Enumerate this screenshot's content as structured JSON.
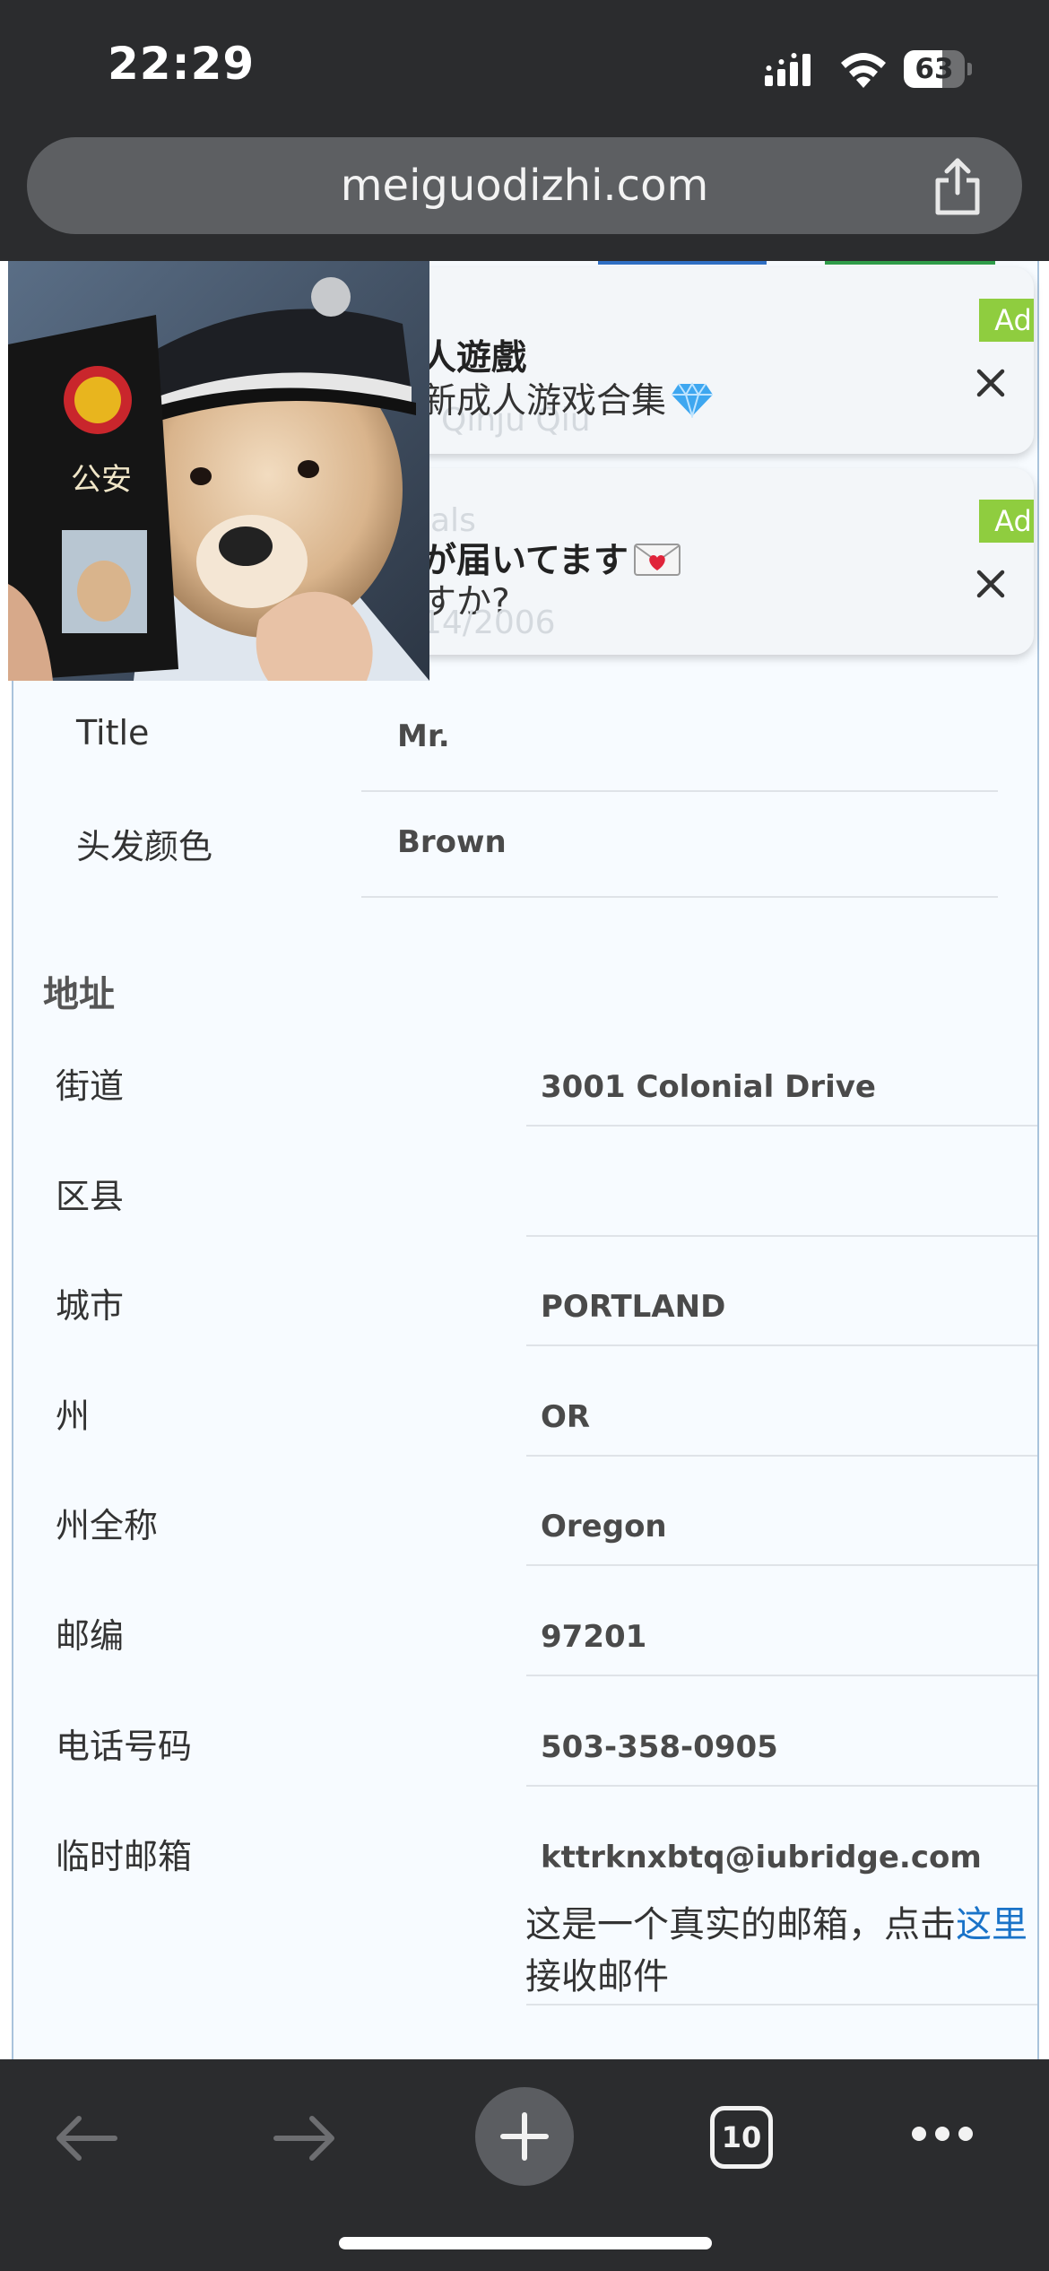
{
  "status_bar": {
    "time": "22:29",
    "battery_percent": "63",
    "battery_level": 0.63
  },
  "browser": {
    "url": "meiguodizhi.com"
  },
  "ads": [
    {
      "ghost_text": "Qinju Qiu",
      "title": "人遊戲",
      "subtitle": "新成人游戏合集",
      "badge": "Ad"
    },
    {
      "ghost_text_top": "als",
      "ghost_text_bottom": "14/2006",
      "title": "が届いてます",
      "subtitle": "すか?",
      "badge": "Ad"
    }
  ],
  "meme": {
    "card_text": "公安"
  },
  "profile": [
    {
      "label": "Title",
      "value": "Mr."
    },
    {
      "label": "头发颜色",
      "value": "Brown"
    }
  ],
  "address": {
    "heading": "地址",
    "rows": [
      {
        "label": "街道",
        "value": "3001  Colonial Drive"
      },
      {
        "label": "区县",
        "value": ""
      },
      {
        "label": "城市",
        "value": "PORTLAND"
      },
      {
        "label": "州",
        "value": "OR"
      },
      {
        "label": "州全称",
        "value": "Oregon"
      },
      {
        "label": "邮编",
        "value": "97201"
      },
      {
        "label": "电话号码",
        "value": "503-358-0905"
      },
      {
        "label": "临时邮箱",
        "value": "kttrknxbtq@iubridge.com"
      }
    ],
    "email_note_before": "这是一个真实的邮箱，点击",
    "email_note_link": "这里",
    "email_note_after": "接收邮件"
  },
  "toolbar": {
    "tab_count": "10"
  },
  "colors": {
    "accent_link": "#1a73c8",
    "ad_badge": "#8fcd3f",
    "chrome": "#2b2c2e"
  }
}
